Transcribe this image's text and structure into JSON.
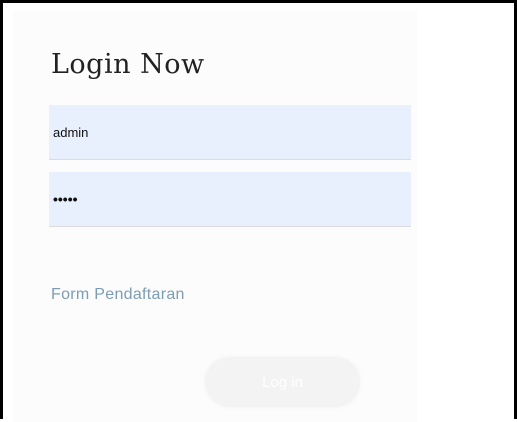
{
  "login": {
    "title": "Login Now",
    "username_value": "admin",
    "password_value": "•••••",
    "register_link": "Form Pendaftaran",
    "login_button": "Log in"
  },
  "colors": {
    "field_bg": "#e8f0fe",
    "link": "#7d9cb6",
    "button_bg": "#f3f3f3",
    "button_text": "#ffffff"
  }
}
